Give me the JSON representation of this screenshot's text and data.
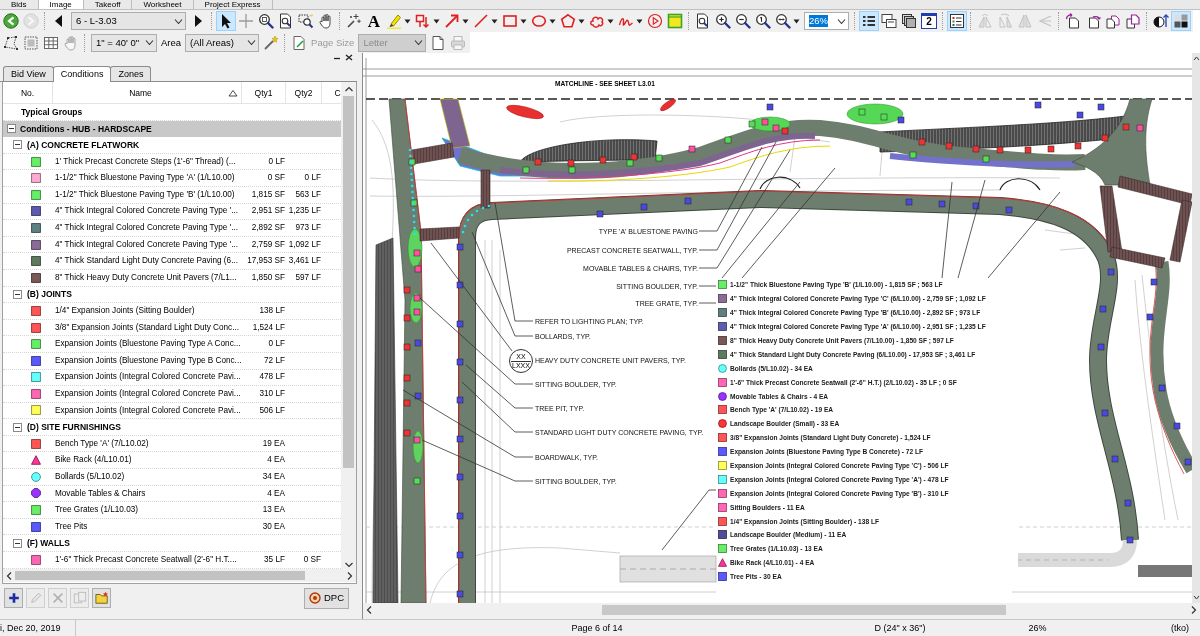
{
  "app_tabs": [
    {
      "label": "Bids",
      "selected": false
    },
    {
      "label": "Image",
      "selected": true
    },
    {
      "label": "Takeoff",
      "selected": false
    },
    {
      "label": "Worksheet",
      "selected": false
    },
    {
      "label": "Project Express",
      "selected": false
    }
  ],
  "toolbar": [
    [
      {
        "kind": "back",
        "selected": false,
        "disabled": false,
        "dropdown": false
      },
      {
        "kind": "forward",
        "selected": false,
        "disabled": true,
        "dropdown": false
      }
    ],
    [
      {
        "kind": "prev",
        "selected": false,
        "disabled": false,
        "dropdown": false
      },
      {
        "kind": "page_select",
        "value": "6 - L-3.03",
        "highlighted": false,
        "disabled": false
      },
      {
        "kind": "next",
        "selected": false,
        "disabled": false,
        "dropdown": false
      }
    ],
    [
      {
        "kind": "pointer",
        "selected": true,
        "disabled": false,
        "dropdown": false
      },
      {
        "kind": "crosshair",
        "selected": false,
        "disabled": false,
        "dropdown": false
      },
      {
        "kind": "zoom_tool",
        "selected": false,
        "disabled": false,
        "dropdown": false
      },
      {
        "kind": "zoom_page",
        "selected": false,
        "disabled": false,
        "dropdown": false
      },
      {
        "kind": "zoom_window",
        "selected": false,
        "disabled": false,
        "dropdown": false
      },
      {
        "kind": "pan",
        "selected": false,
        "disabled": false,
        "dropdown": false
      }
    ],
    [
      {
        "kind": "sparkle_cursor",
        "selected": false,
        "disabled": false,
        "dropdown": false
      },
      {
        "kind": "text",
        "label": "A",
        "selected": false,
        "disabled": false,
        "dropdown": false
      },
      {
        "kind": "highlighter",
        "selected": false,
        "disabled": false,
        "dropdown": true
      },
      {
        "kind": "callout",
        "selected": false,
        "disabled": false,
        "dropdown": true
      },
      {
        "kind": "arrow",
        "selected": false,
        "disabled": false,
        "dropdown": true
      },
      {
        "kind": "line",
        "selected": false,
        "disabled": false,
        "dropdown": true
      },
      {
        "kind": "rectangle",
        "selected": false,
        "disabled": false,
        "dropdown": true
      },
      {
        "kind": "ellipse",
        "selected": false,
        "disabled": false,
        "dropdown": true
      },
      {
        "kind": "polygon",
        "selected": false,
        "disabled": false,
        "dropdown": true
      },
      {
        "kind": "cloud",
        "selected": false,
        "disabled": false,
        "dropdown": true
      },
      {
        "kind": "freehand",
        "selected": false,
        "disabled": false,
        "dropdown": true
      },
      {
        "kind": "play",
        "selected": false,
        "disabled": false,
        "dropdown": false
      },
      {
        "kind": "note",
        "selected": false,
        "disabled": false,
        "dropdown": false
      }
    ],
    [
      {
        "kind": "zoom_fit",
        "selected": false,
        "disabled": false,
        "dropdown": false
      },
      {
        "kind": "zoom_in",
        "selected": false,
        "disabled": false,
        "dropdown": false
      },
      {
        "kind": "zoom_out",
        "selected": false,
        "disabled": false,
        "dropdown": false
      },
      {
        "kind": "zoom_actual",
        "selected": false,
        "disabled": false,
        "dropdown": false
      },
      {
        "kind": "zoom_width",
        "selected": false,
        "disabled": false,
        "dropdown": true
      },
      {
        "kind": "zoom_select",
        "value": "26%",
        "highlighted": true,
        "disabled": false
      }
    ],
    [
      {
        "kind": "list",
        "selected": true,
        "disabled": false,
        "dropdown": false
      },
      {
        "kind": "overlay",
        "selected": false,
        "disabled": false,
        "dropdown": false
      },
      {
        "kind": "layers",
        "selected": false,
        "disabled": false,
        "dropdown": false
      },
      {
        "kind": "page_number",
        "label": "2",
        "selected": false,
        "disabled": false,
        "dropdown": false
      }
    ],
    [
      {
        "kind": "legend",
        "selected": true,
        "disabled": false,
        "dropdown": false
      }
    ],
    [
      {
        "kind": "flip_h",
        "selected": false,
        "disabled": true,
        "dropdown": false
      },
      {
        "kind": "flip_v",
        "selected": false,
        "disabled": true,
        "dropdown": false
      },
      {
        "kind": "mirror",
        "selected": false,
        "disabled": true,
        "dropdown": false
      },
      {
        "kind": "skew",
        "selected": false,
        "disabled": true,
        "dropdown": false
      }
    ],
    [
      {
        "kind": "page_prev",
        "selected": false,
        "disabled": false,
        "dropdown": false
      },
      {
        "kind": "page_next",
        "selected": false,
        "disabled": false,
        "dropdown": false
      },
      {
        "kind": "page_copy",
        "selected": false,
        "disabled": false,
        "dropdown": false
      },
      {
        "kind": "page_move",
        "selected": false,
        "disabled": false,
        "dropdown": false
      }
    ],
    [
      {
        "kind": "contrast",
        "selected": false,
        "disabled": false,
        "dropdown": false
      },
      {
        "kind": "grayscale",
        "selected": true,
        "disabled": false,
        "dropdown": false
      }
    ]
  ],
  "toolbar_2": [
    [
      {
        "kind": "polygon_select",
        "selected": false,
        "disabled": false,
        "dropdown": false
      },
      {
        "kind": "region_select",
        "selected": false,
        "disabled": false,
        "dropdown": false
      },
      {
        "kind": "grid",
        "selected": false,
        "disabled": false,
        "dropdown": false
      },
      {
        "kind": "pan",
        "selected": false,
        "disabled": true,
        "dropdown": false
      }
    ],
    [
      {
        "kind": "scale_select",
        "value": "1\" = 40' 0\"",
        "highlighted": false,
        "disabled": false
      },
      {
        "kind": "area_label",
        "text": "Area",
        "disabled": false
      },
      {
        "kind": "area_select",
        "value": "(All Areas)",
        "highlighted": false,
        "disabled": false
      },
      {
        "kind": "wand",
        "selected": false,
        "disabled": false,
        "dropdown": false
      }
    ],
    [
      {
        "kind": "page_setup",
        "selected": false,
        "disabled": false,
        "dropdown": false
      },
      {
        "kind": "size_label",
        "text": "Page Size",
        "disabled": true
      },
      {
        "kind": "paper_select",
        "value": "Letter",
        "highlighted": false,
        "disabled": true
      },
      {
        "kind": "new_page",
        "selected": false,
        "disabled": false,
        "dropdown": false
      },
      {
        "kind": "print",
        "selected": false,
        "disabled": true,
        "dropdown": false
      }
    ]
  ],
  "panel": {
    "tabs": [
      {
        "label": "Bid View",
        "selected": false
      },
      {
        "label": "Conditions",
        "selected": true
      },
      {
        "label": "Zones",
        "selected": false
      }
    ],
    "columns": [
      {
        "label": "No.",
        "sorted": false
      },
      {
        "label": "Name",
        "sorted": true
      },
      {
        "label": "Qty1",
        "sorted": false
      },
      {
        "label": "Qty2",
        "sorted": false
      },
      {
        "label": "C",
        "sorted": false
      }
    ],
    "section_label": "Typical Groups",
    "groups": [
      {
        "name": "Conditions - HUB - HARDSCAPE",
        "expanded": true,
        "children": [
          {
            "name": "(A) CONCRETE FLATWORK",
            "expanded": true,
            "children": [
              {
                "kind": "square",
                "color": "#66ee66",
                "name": "1' Thick Precast Concrete Steps (1'-6\" Thread) (...",
                "qty1": "0 LF"
              },
              {
                "kind": "square",
                "color": "#ffaad4",
                "name": "1-1/2\" Thick Bluestone Paving Type 'A' (1/L10.00)",
                "qty1": "0 SF",
                "qty2": "0 LF"
              },
              {
                "kind": "square",
                "color": "#66ee66",
                "name": "1-1/2\" Thick Bluestone Paving Type 'B' (1/L10.00)",
                "qty1": "1,815 SF",
                "qty2": "563 LF"
              },
              {
                "kind": "square",
                "color": "#5c5cae",
                "name": "4\" Thick Integral Colored Concrete Paving Type '...",
                "qty1": "2,951 SF",
                "qty2": "1,235 LF"
              },
              {
                "kind": "square",
                "color": "#5f8080",
                "name": "4\" Thick Integral Colored Concrete Paving Type '...",
                "qty1": "2,892 SF",
                "qty2": "973 LF"
              },
              {
                "kind": "square",
                "color": "#8a6c96",
                "name": "4\" Thick Integral Colored Concrete Paving Type '...",
                "qty1": "2,759 SF",
                "qty2": "1,092 LF"
              },
              {
                "kind": "square",
                "color": "#5e7a5e",
                "name": "4\" Thick Standard Light Duty Concrete Paving (6...",
                "qty1": "17,953 SF",
                "qty2": "3,461 LF"
              },
              {
                "kind": "square",
                "color": "#7a5858",
                "name": "8\" Thick Heavy Duty Concrete Unit Pavers (7/L1...",
                "qty1": "1,850 SF",
                "qty2": "597 LF"
              }
            ]
          },
          {
            "name": "(B) JOINTS",
            "expanded": true,
            "children": [
              {
                "kind": "square",
                "color": "#ff5555",
                "name": "1/4\" Expansion Joints (Sitting Boulder)",
                "qty1": "138 LF"
              },
              {
                "kind": "square",
                "color": "#ff5555",
                "name": "3/8\" Expansion Joints (Standard Light Duty Conc...",
                "qty1": "1,524 LF"
              },
              {
                "kind": "square",
                "color": "#66ee66",
                "name": "Expansion Joints (Bluestone Paving Type A Conc...",
                "qty1": "0 LF"
              },
              {
                "kind": "square",
                "color": "#5a5aff",
                "name": "Expansion Joints (Bluestone Paving Type B Conc...",
                "qty1": "72 LF"
              },
              {
                "kind": "square",
                "color": "#66ffff",
                "name": "Expansion Joints (Integral Colored Concrete Pavi...",
                "qty1": "478 LF"
              },
              {
                "kind": "square",
                "color": "#ff66b3",
                "name": "Expansion Joints (Integral Colored Concrete Pavi...",
                "qty1": "310 LF"
              },
              {
                "kind": "square",
                "color": "#ffff55",
                "name": "Expansion Joints (Integral Colored Concrete Pavi...",
                "qty1": "506 LF"
              }
            ]
          },
          {
            "name": "(D) SITE FURNISHINGS",
            "expanded": true,
            "children": [
              {
                "kind": "square",
                "color": "#ff5555",
                "name": "Bench Type 'A' (7/L10.02)",
                "qty1": "19 EA"
              },
              {
                "kind": "triangle",
                "color": "#ff3399",
                "name": "Bike Rack (4/L10.01)",
                "qty1": "4 EA"
              },
              {
                "kind": "circle",
                "color": "#66ffff",
                "name": "Bollards (5/L10.02)",
                "qty1": "34 EA"
              },
              {
                "kind": "octagon",
                "color": "#9933ff",
                "name": "Movable Tables & Chairs",
                "qty1": "4 EA"
              },
              {
                "kind": "square",
                "color": "#66ee66",
                "name": "Tree Grates (1/L10.03)",
                "qty1": "13 EA"
              },
              {
                "kind": "square",
                "color": "#5a5aff",
                "name": "Tree Pits",
                "qty1": "30 EA"
              }
            ]
          },
          {
            "name": "(F) WALLS",
            "expanded": true,
            "children": [
              {
                "kind": "square",
                "color": "#ff66b3",
                "name": "1'-6\" Thick Precast Concrete Seatwall (2'-6\" H.T....",
                "qty1": "35 LF",
                "qty2": "0 SF"
              }
            ]
          }
        ]
      }
    ],
    "actions": [
      {
        "kind": "add",
        "disabled": false
      },
      {
        "kind": "edit",
        "disabled": true
      },
      {
        "kind": "delete",
        "disabled": true
      },
      {
        "kind": "copy",
        "disabled": true
      },
      {
        "kind": "folder",
        "disabled": false
      }
    ],
    "dpc_button": {
      "label": "DPC"
    }
  },
  "drawing": {
    "matchline": "MATCHLINE - SEE SHEET L3.01",
    "callouts": [
      "TYPE 'A' BLUESTONE PAVING",
      "PRECAST CONCRETE SEATWALL, TYP.",
      "MOVABLE TABLES & CHAIRS, TYP.",
      "SITTING BOULDER, TYP.",
      "TREE GRATE, TYP.",
      "REFER TO LIGHTING PLAN; TYP.",
      "BOLLARDS, TYP.",
      "HEAVY DUTY CONCRETE UNIT PAVERS, TYP.",
      "SITTING BOULDER, TYP.",
      "TREE PIT, TYP.",
      "STANDARD LIGHT DUTY CONCRETE PAVING, TYP.",
      "BOARDWALK, TYP.",
      "SITTING BOULDER, TYP."
    ],
    "section_marker": {
      "top": "XX",
      "bottom": "LXXX"
    },
    "legend": [
      {
        "kind": "square",
        "color": "#66ee66",
        "text": "1-1/2\" Thick Bluestone Paving Type 'B' (1/L10.00) - 1,815 SF ; 563 LF"
      },
      {
        "kind": "square",
        "color": "#8a6c96",
        "text": "4\" Thick Integral Colored Concrete Paving Type 'C' (6/L10.00) - 2,759 SF ; 1,092 LF"
      },
      {
        "kind": "square",
        "color": "#5f8080",
        "text": "4\" Thick Integral Colored Concrete Paving Type 'B' (6/L10.00) - 2,892 SF ; 973 LF"
      },
      {
        "kind": "square",
        "color": "#5c5cae",
        "text": "4\" Thick Integral Colored Concrete Paving Type 'A' (6/L10.00) - 2,951 SF ; 1,235 LF"
      },
      {
        "kind": "square",
        "color": "#7a5858",
        "text": "8\" Thick Heavy Duty Concrete Unit Pavers (7/L10.00) - 1,850 SF ; 597 LF"
      },
      {
        "kind": "square",
        "color": "#5e7a5e",
        "text": "4\" Thick Standard Light Duty Concrete Paving (6/L10.00) - 17,953 SF ; 3,461 LF"
      },
      {
        "kind": "circle",
        "color": "#66ffff",
        "text": "Bollards (5/L10.02) - 34 EA"
      },
      {
        "kind": "square",
        "color": "#ff66b3",
        "text": "1'-6\" Thick Precast Concrete Seatwall (2'-6\" H.T.) (2/L10.02) - 35 LF ; 0 SF"
      },
      {
        "kind": "circle",
        "color": "#9933ff",
        "text": "Movable Tables & Chairs - 4 EA"
      },
      {
        "kind": "square",
        "color": "#ff5555",
        "text": "Bench Type 'A' (7/L10.02) - 19 EA"
      },
      {
        "kind": "circle",
        "color": "#ff3333",
        "text": "Landscape Boulder (Small) - 33 EA"
      },
      {
        "kind": "square",
        "color": "#ff5555",
        "text": "3/8\" Expansion Joints (Standard Light Duty Concrete) - 1,524 LF"
      },
      {
        "kind": "square",
        "color": "#5a5aff",
        "text": "Expansion Joints (Bluestone Paving Type B Concrete) - 72 LF"
      },
      {
        "kind": "square",
        "color": "#ffff55",
        "text": "Expansion Joints (Integral Colored Concrete Paving Type 'C') - 506 LF"
      },
      {
        "kind": "square",
        "color": "#66ffff",
        "text": "Expansion Joints (Integral Colored Concrete Paving Type 'A') - 478 LF"
      },
      {
        "kind": "square",
        "color": "#ff66b3",
        "text": "Expansion Joints (Integral Colored Concrete Paving Type 'B') - 310 LF"
      },
      {
        "kind": "square",
        "color": "#ff66b3",
        "text": "Sitting Boulders - 11 EA"
      },
      {
        "kind": "square",
        "color": "#ff5555",
        "text": "1/4\" Expansion Joints (Sitting Boulder) - 138 LF"
      },
      {
        "kind": "square",
        "color": "#4d4d99",
        "text": "Landscape Boulder (Medium) - 11 EA"
      },
      {
        "kind": "square",
        "color": "#66ee66",
        "text": "Tree Grates (1/L10.03) - 13 EA"
      },
      {
        "kind": "triangle",
        "color": "#ff3399",
        "text": "Bike Rack (4/L10.01) - 4 EA"
      },
      {
        "kind": "square",
        "color": "#5a5aff",
        "text": "Tree Pits - 30 EA"
      }
    ]
  },
  "status_bar": {
    "date": "i, Dec 20, 2019",
    "page": "Page 6 of 14",
    "sheet_size": "D (24\" x 36\")",
    "zoom": "26%",
    "field_5": "(tko)"
  }
}
